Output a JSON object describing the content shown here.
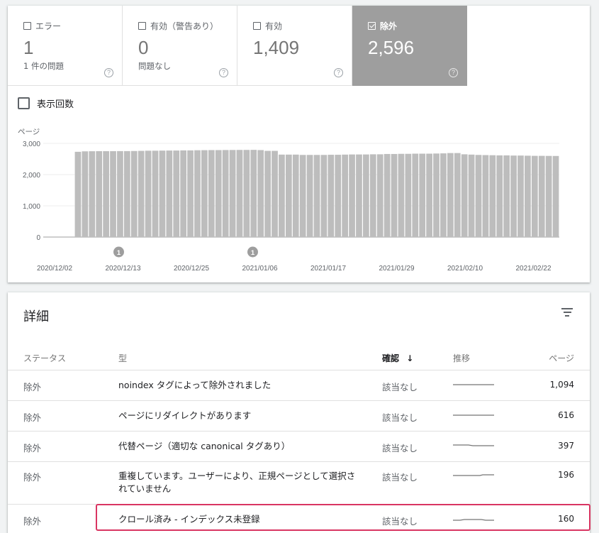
{
  "tiles": [
    {
      "label": "エラー",
      "count": "1",
      "sub": "1 件の問題",
      "checked": false
    },
    {
      "label": "有効（警告あり）",
      "count": "0",
      "sub": "問題なし",
      "checked": false
    },
    {
      "label": "有効",
      "count": "1,409",
      "sub": "",
      "checked": false
    },
    {
      "label": "除外",
      "count": "2,596",
      "sub": "",
      "checked": true
    }
  ],
  "help_glyph": "?",
  "impressions_label": "表示回数",
  "chart_data": {
    "type": "bar",
    "ylabel": "ページ",
    "yticks": [
      "3,000",
      "2,000",
      "1,000",
      "0"
    ],
    "ylim": [
      0,
      3000
    ],
    "xticks": [
      "2020/12/02",
      "2020/12/13",
      "2020/12/25",
      "2021/01/06",
      "2021/01/17",
      "2021/01/29",
      "2021/02/10",
      "2021/02/22"
    ],
    "values": [
      2730,
      2745,
      2748,
      2750,
      2750,
      2750,
      2752,
      2752,
      2755,
      2760,
      2765,
      2765,
      2768,
      2770,
      2770,
      2775,
      2775,
      2780,
      2782,
      2785,
      2785,
      2787,
      2788,
      2790,
      2790,
      2792,
      2785,
      2760,
      2760,
      2640,
      2640,
      2640,
      2630,
      2630,
      2630,
      2630,
      2635,
      2635,
      2640,
      2645,
      2645,
      2645,
      2650,
      2650,
      2660,
      2660,
      2665,
      2665,
      2670,
      2670,
      2670,
      2675,
      2680,
      2690,
      2690,
      2650,
      2640,
      2630,
      2625,
      2620,
      2615,
      2615,
      2610,
      2610,
      2605,
      2600,
      2600,
      2598,
      2596
    ],
    "annotations": [
      {
        "label": "1",
        "at": "2020/12/13"
      },
      {
        "label": "1",
        "at": "2021/01/06"
      }
    ],
    "grid": true,
    "bar_color": "#bdbdbd"
  },
  "details": {
    "title": "詳細",
    "columns": {
      "status": "ステータス",
      "type": "型",
      "validation": "確認",
      "trend": "推移",
      "pages": "ページ"
    },
    "sort_arrow": "↓",
    "rows": [
      {
        "status": "除外",
        "type": "noindex タグによって除外されました",
        "validation": "該当なし",
        "pages": "1,094",
        "trend": "flat"
      },
      {
        "status": "除外",
        "type": "ページにリダイレクトがあります",
        "validation": "該当なし",
        "pages": "616",
        "trend": "flat"
      },
      {
        "status": "除外",
        "type": "代替ページ（適切な canonical タグあり）",
        "validation": "該当なし",
        "pages": "397",
        "trend": "step-down"
      },
      {
        "status": "除外",
        "type": "重複しています。ユーザーにより、正規ページとして選択されていません",
        "validation": "該当なし",
        "pages": "196",
        "trend": "step-up"
      },
      {
        "status": "除外",
        "type": "クロール済み - インデックス未登録",
        "validation": "該当なし",
        "pages": "160",
        "trend": "hump"
      }
    ]
  },
  "colors": {
    "accent_highlight": "#d93562",
    "selected_tile": "#9e9e9e"
  }
}
